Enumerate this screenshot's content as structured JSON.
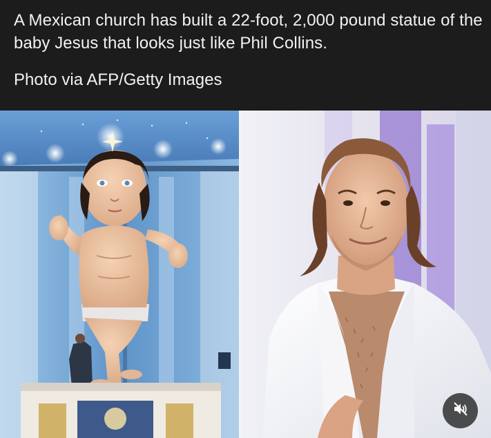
{
  "post": {
    "caption": "A Mexican church has built a 22-foot, 2,000 pound statue of the baby Jesus that looks just like Phil Collins.",
    "credit": "Photo via AFP/Getty Images"
  },
  "media": {
    "left_image": "giant-baby-jesus-statue-photo",
    "right_image": "phil-collins-photo",
    "mute_icon": "speaker-muted-icon"
  },
  "colors": {
    "background": "#1c1c1c",
    "caption_text": "#f2f2f2",
    "divider": "#f4f4f4",
    "mute_button_bg": "#282828"
  }
}
